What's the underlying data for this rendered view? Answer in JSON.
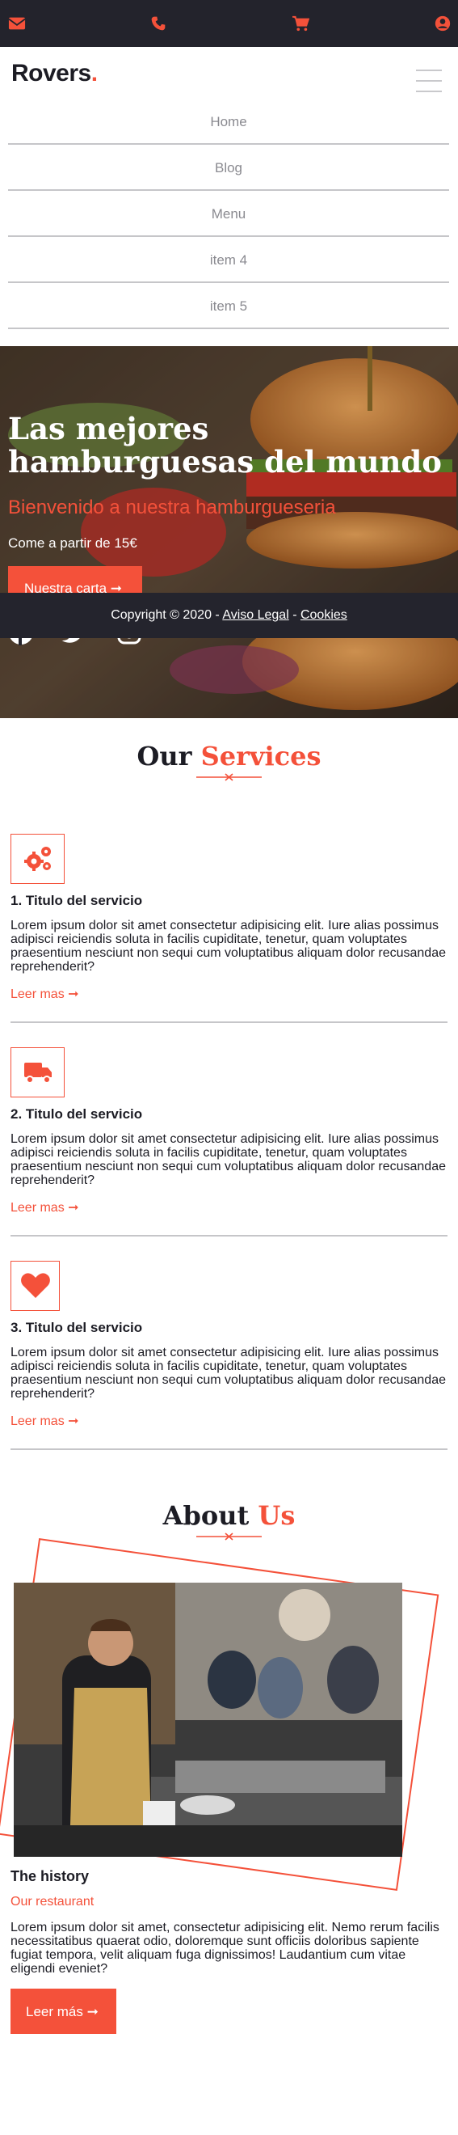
{
  "topbar": {
    "icons": [
      "envelope-icon",
      "phone-icon",
      "cart-icon",
      "user-icon"
    ],
    "bg_color": "#23232c",
    "accent_color": "#f4513a"
  },
  "brand": {
    "name": "Rovers",
    "dot": "."
  },
  "nav": {
    "items": [
      "Home",
      "Blog",
      "Menu",
      "item 4",
      "item 5"
    ]
  },
  "hero": {
    "title": "Las mejores hamburguesas del mundo",
    "subtitle": "Bienvenido a nuestra hamburgueseria",
    "price_text": "Come a partir de 15€",
    "button_label": "Nuestra carta ➞",
    "social_icons": [
      "facebook-icon",
      "twitter-icon",
      "instagram-icon"
    ]
  },
  "footer_bar": {
    "copyright": "Copyright © 2020 - ",
    "legal_link": "Aviso Legal",
    "separator": " - ",
    "cookies_link": "Cookies"
  },
  "services": {
    "title_a": "Our ",
    "title_b": "Services",
    "items": [
      {
        "icon": "gears-icon",
        "title": "1. Titulo del servicio",
        "text": "Lorem ipsum dolor sit amet consectetur adipisicing elit. Iure alias possimus adipisci reiciendis soluta in facilis cupiditate, tenetur, quam voluptates praesentium nesciunt non sequi cum voluptatibus aliquam dolor recusandae reprehenderit?",
        "more": "Leer mas ➞"
      },
      {
        "icon": "truck-icon",
        "title": "2. Titulo del servicio",
        "text": "Lorem ipsum dolor sit amet consectetur adipisicing elit. Iure alias possimus adipisci reiciendis soluta in facilis cupiditate, tenetur, quam voluptates praesentium nesciunt non sequi cum voluptatibus aliquam dolor recusandae reprehenderit?",
        "more": "Leer mas ➞"
      },
      {
        "icon": "heart-icon",
        "title": "3. Titulo del servicio",
        "text": "Lorem ipsum dolor sit amet consectetur adipisicing elit. Iure alias possimus adipisci reiciendis soluta in facilis cupiditate, tenetur, quam voluptates praesentium nesciunt non sequi cum voluptatibus aliquam dolor recusandae reprehenderit?",
        "more": "Leer mas ➞"
      }
    ]
  },
  "about": {
    "title_a": "About ",
    "title_b": "Us",
    "heading": "The history",
    "subheading": "Our restaurant",
    "text": "Lorem ipsum dolor sit amet, consectetur adipisicing elit. Nemo rerum facilis necessitatibus quaerat odio, doloremque sunt officiis doloribus sapiente fugiat tempora, velit aliquam fuga dignissimos! Laudantium cum vitae eligendi eveniet?",
    "button_label": "Leer más ➞"
  }
}
